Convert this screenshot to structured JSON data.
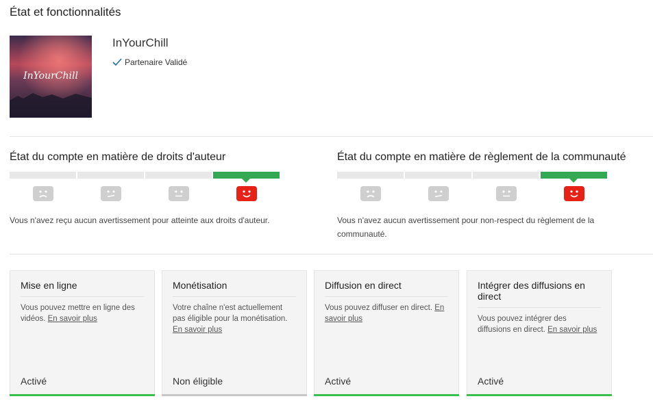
{
  "page": {
    "title": "État et fonctionnalités"
  },
  "channel": {
    "name": "InYourChill",
    "logo_text": "InYourChill",
    "partner_label": "Partenaire Validé"
  },
  "copyright": {
    "title": "État du compte en matière de droits d'auteur",
    "description": "Vous n'avez reçu aucun avertissement pour atteinte aux droits d'auteur.",
    "active_level": 4
  },
  "community": {
    "title": "État du compte en matière de règlement de la communauté",
    "description": "Vous n'avez aucun avertissement pour non-respect du règlement de la communauté.",
    "active_level": 4
  },
  "colors": {
    "good": "#35a853",
    "active_face": "#e62117",
    "inactive_face": "#cfcfcf"
  },
  "cards": [
    {
      "title": "Mise en ligne",
      "desc": "Vous pouvez mettre en ligne des vidéos.",
      "link": "En savoir plus",
      "status": "Activé"
    },
    {
      "title": "Monétisation",
      "desc": "Votre chaîne n'est actuellement pas éligible pour la monétisation.",
      "link": "En savoir plus",
      "status": "Non éligible"
    },
    {
      "title": "Diffusion en direct",
      "desc": "Vous pouvez diffuser en direct.",
      "link": "En savoir plus",
      "status": "Activé"
    },
    {
      "title": "Intégrer des diffusions en direct",
      "desc": "Vous pouvez intégrer des diffusions en direct.",
      "link": "En savoir plus",
      "status": "Activé"
    }
  ]
}
